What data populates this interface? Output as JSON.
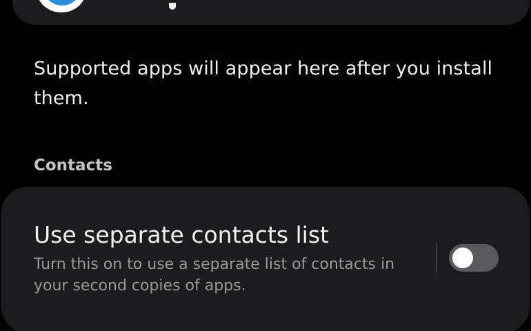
{
  "top_card": {
    "icon": "app-icon"
  },
  "info": {
    "text": "Supported apps will appear here after you install them."
  },
  "contacts_section": {
    "header": "Contacts",
    "setting": {
      "title": "Use separate contacts list",
      "description": "Turn this on to use a separate list of contacts in your second copies of apps.",
      "toggle_state": "off"
    }
  },
  "colors": {
    "background": "#000000",
    "card": "#1c1c1e",
    "toggle_track_off": "#5a5a5c",
    "app_icon_accent": "#2d8fde"
  }
}
